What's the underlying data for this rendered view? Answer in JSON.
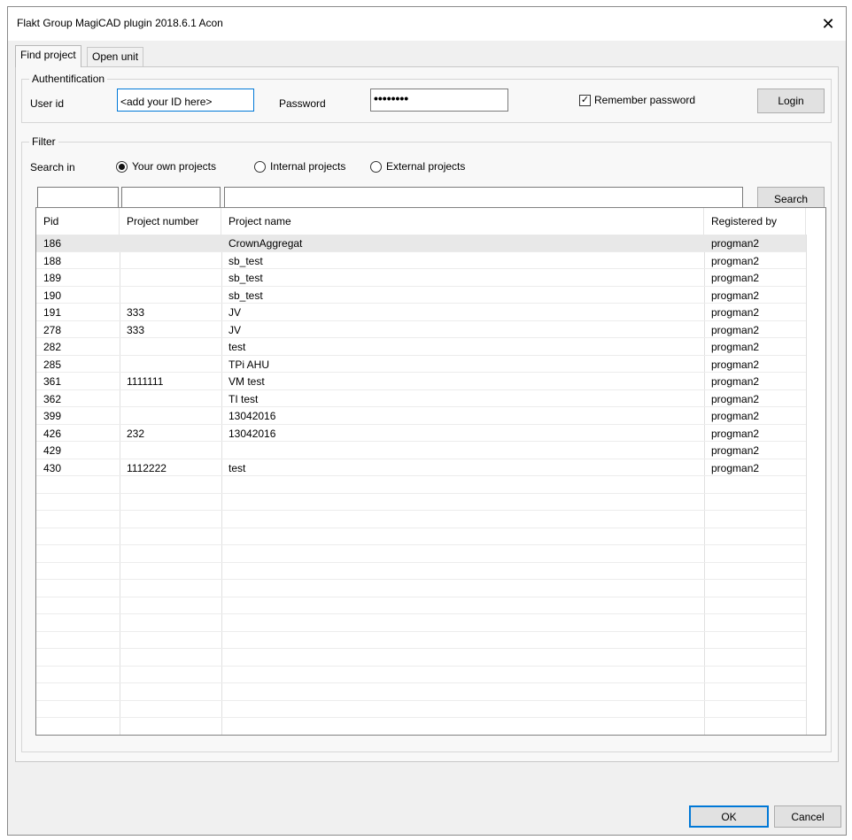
{
  "window": {
    "title": "Flakt Group MagiCAD plugin 2018.6.1 Acon",
    "close_glyph": "✕"
  },
  "tabs": [
    {
      "label": "Find project",
      "active": true
    },
    {
      "label": "Open unit",
      "active": false
    }
  ],
  "auth": {
    "group_label": "Authentification",
    "user_id_label": "User id",
    "user_id_value": "<add your ID here>",
    "password_label": "Password",
    "password_value": "••••••••",
    "remember_label": "Remember password",
    "remember_checked": true,
    "login_label": "Login"
  },
  "filter": {
    "group_label": "Filter",
    "search_in_label": "Search in",
    "options": [
      {
        "label": "Your own projects",
        "selected": true
      },
      {
        "label": "Internal projects",
        "selected": false
      },
      {
        "label": "External projects",
        "selected": false
      }
    ],
    "search_label": "Search",
    "field_values": [
      "",
      "",
      ""
    ]
  },
  "table": {
    "columns": [
      "Pid",
      "Project number",
      "Project name",
      "Registered by"
    ],
    "rows": [
      {
        "pid": "186",
        "number": "",
        "name": "CrownAggregat",
        "by": "progman2"
      },
      {
        "pid": "188",
        "number": "",
        "name": "sb_test",
        "by": "progman2"
      },
      {
        "pid": "189",
        "number": "",
        "name": "sb_test",
        "by": "progman2"
      },
      {
        "pid": "190",
        "number": "",
        "name": "sb_test",
        "by": "progman2"
      },
      {
        "pid": "191",
        "number": "333",
        "name": "JV",
        "by": "progman2"
      },
      {
        "pid": "278",
        "number": "333",
        "name": "JV",
        "by": "progman2"
      },
      {
        "pid": "282",
        "number": "",
        "name": "test",
        "by": "progman2"
      },
      {
        "pid": "285",
        "number": "",
        "name": "TPi AHU",
        "by": "progman2"
      },
      {
        "pid": "361",
        "number": "1111111",
        "name": "VM test",
        "by": "progman2"
      },
      {
        "pid": "362",
        "number": "",
        "name": "TI test",
        "by": "progman2"
      },
      {
        "pid": "399",
        "number": "",
        "name": "13042016",
        "by": "progman2"
      },
      {
        "pid": "426",
        "number": "232",
        "name": "13042016",
        "by": "progman2"
      },
      {
        "pid": "429",
        "number": "",
        "name": "",
        "by": "progman2"
      },
      {
        "pid": "430",
        "number": "1112222",
        "name": "test",
        "by": "progman2"
      }
    ]
  },
  "footer": {
    "ok_label": "OK",
    "cancel_label": "Cancel"
  }
}
